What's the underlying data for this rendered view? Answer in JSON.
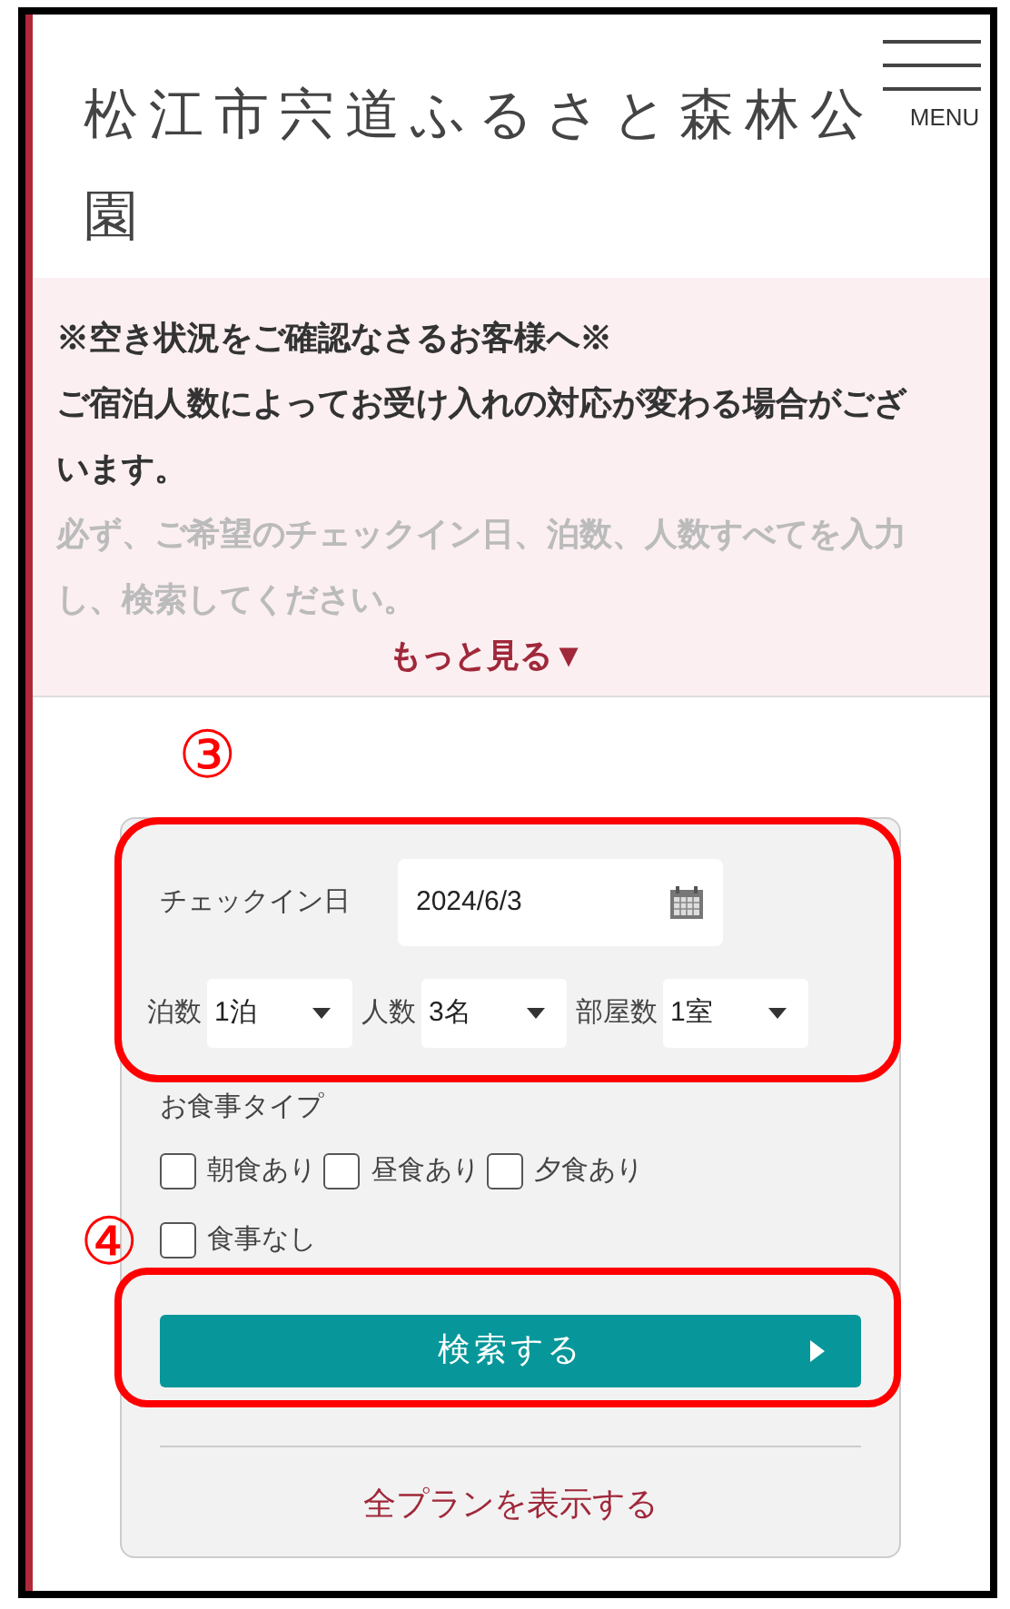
{
  "header": {
    "title": "松江市宍道ふるさと森林公園",
    "menu_label": "MENU"
  },
  "notice": {
    "lines": [
      {
        "text": "※空き状況をご確認なさるお客様へ※",
        "faded": false
      },
      {
        "text": "ご宿泊人数によってお受け入れの対応が変わる場合がございます。",
        "faded": false
      },
      {
        "text": "必ず、ご希望のチェックイン日、泊数、人数すべてを入力し、検索してください。",
        "faded": true
      }
    ],
    "more_link": "もっと見る▼"
  },
  "annotations": [
    {
      "label": "③"
    },
    {
      "label": "④"
    }
  ],
  "search_form": {
    "checkin": {
      "label": "チェックイン日",
      "value": "2024/6/3"
    },
    "selects": [
      {
        "label": "泊数",
        "value": "1泊"
      },
      {
        "label": "人数",
        "value": "3名"
      },
      {
        "label": "部屋数",
        "value": "1室"
      }
    ],
    "meal_type": {
      "label": "お食事タイプ",
      "options": [
        {
          "label": "朝食あり",
          "checked": false
        },
        {
          "label": "昼食あり",
          "checked": false
        },
        {
          "label": "夕食あり",
          "checked": false
        },
        {
          "label": "食事なし",
          "checked": false
        }
      ]
    },
    "search_button": "検索する",
    "all_plans_link": "全プランを表示する"
  }
}
